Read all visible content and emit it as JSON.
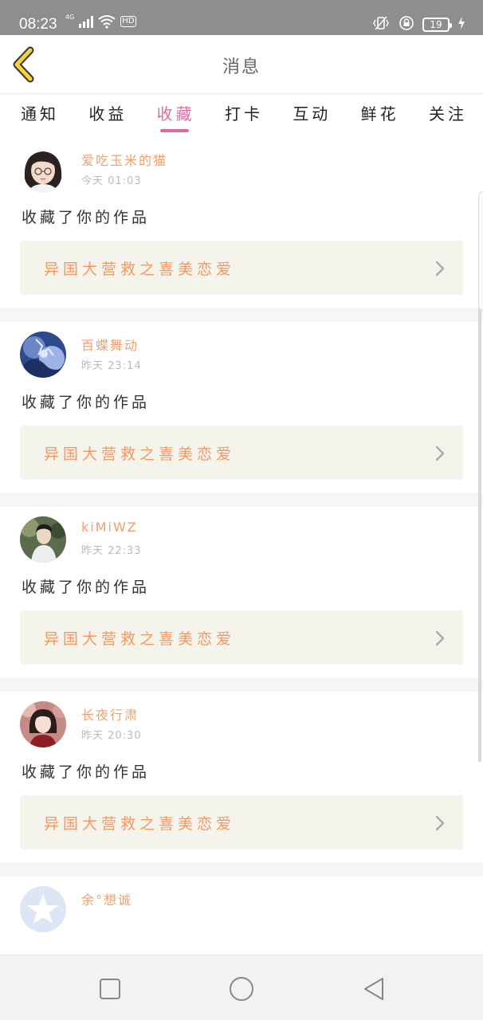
{
  "status_bar": {
    "time": "08:23",
    "network": "4G",
    "hd_label": "HD",
    "battery": "19",
    "icons": [
      "signal-icon",
      "wifi-icon",
      "vibrate-icon",
      "rotation-lock-icon",
      "battery-icon",
      "charging-icon"
    ]
  },
  "header": {
    "title": "消息",
    "back_icon": "back-chevron-icon"
  },
  "tabs": [
    {
      "label": "通知",
      "active": false
    },
    {
      "label": "收益",
      "active": false
    },
    {
      "label": "收藏",
      "active": true
    },
    {
      "label": "打卡",
      "active": false
    },
    {
      "label": "互动",
      "active": false
    },
    {
      "label": "鲜花",
      "active": false
    },
    {
      "label": "关注",
      "active": false
    }
  ],
  "feed": {
    "items": [
      {
        "username": "爱吃玉米的猫",
        "time": "今天 01:03",
        "action": "收藏了你的作品",
        "work_title": "异国大营救之喜美恋爱"
      },
      {
        "username": "百蝶舞动",
        "time": "昨天 23:14",
        "action": "收藏了你的作品",
        "work_title": "异国大营救之喜美恋爱"
      },
      {
        "username": "kiMiWZ",
        "time": "昨天 22:33",
        "action": "收藏了你的作品",
        "work_title": "异国大营救之喜美恋爱"
      },
      {
        "username": "长夜行肃",
        "time": "昨天 20:30",
        "action": "收藏了你的作品",
        "work_title": "异国大营救之喜美恋爱"
      },
      {
        "username": "余°想诚",
        "time": "",
        "action": "",
        "work_title": ""
      }
    ]
  },
  "colors": {
    "accent_pink": "#e06aa0",
    "username_orange": "#f0a070",
    "work_title_orange": "#ef9a66",
    "back_chevron_yellow": "#f3d23a"
  },
  "nav_bar": {
    "icons": [
      "recent-apps-icon",
      "home-icon",
      "back-icon"
    ]
  }
}
